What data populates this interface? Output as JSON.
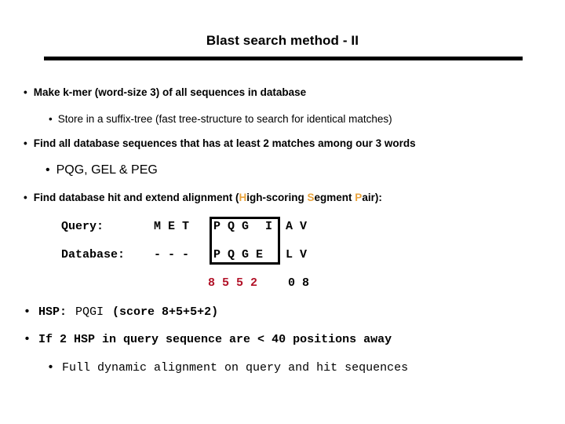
{
  "slide": {
    "title": "Blast search method - II",
    "background_color": "#FFFFFF",
    "accent_colors": {
      "highlight_orange": "#E8A33D",
      "match_red": "#B21228",
      "text_black": "#000000"
    }
  },
  "bullets": {
    "b1": {
      "marker": "•",
      "text": "Make k-mer (word-size 3) of all sequences in database"
    },
    "b2": {
      "marker": "•",
      "text": "Store in a suffix-tree (fast tree-structure to search for identical matches)"
    },
    "b3": {
      "marker": "•",
      "text": "Find all database sequences that has at least 2 matches among our 3 words"
    },
    "b4": {
      "marker": "•",
      "text": "PQG, GEL & PEG"
    },
    "b5": {
      "marker": "•",
      "pre": "Find database hit and extend alignment (",
      "h": "H",
      "igh": "igh-scoring ",
      "s": "S",
      "egment": "egment ",
      "p": "P",
      "post": "air):"
    },
    "b6": {
      "marker": "•",
      "label": "HSP:",
      "hsp_seq": "PQGI",
      "score_expr": "(score 8+5+5+2)"
    },
    "b7": {
      "marker": "•",
      "text": "If 2 HSP in query sequence are < 40 positions away"
    },
    "b8": {
      "marker": "•",
      "text": "Full dynamic alignment on query and hit sequences"
    }
  },
  "alignment": {
    "query": {
      "label": "Query:",
      "left_residues": "M E T",
      "boxed_residues_red": "P Q G",
      "boxed_residues_black": "I",
      "right_residues": "A V"
    },
    "database": {
      "label": "Database:",
      "gaps": "- - -",
      "boxed_residues": "P Q G E",
      "right_residues": "L V"
    },
    "scores": {
      "red_values": "8 5 5 2",
      "black_values": "0 8"
    }
  }
}
